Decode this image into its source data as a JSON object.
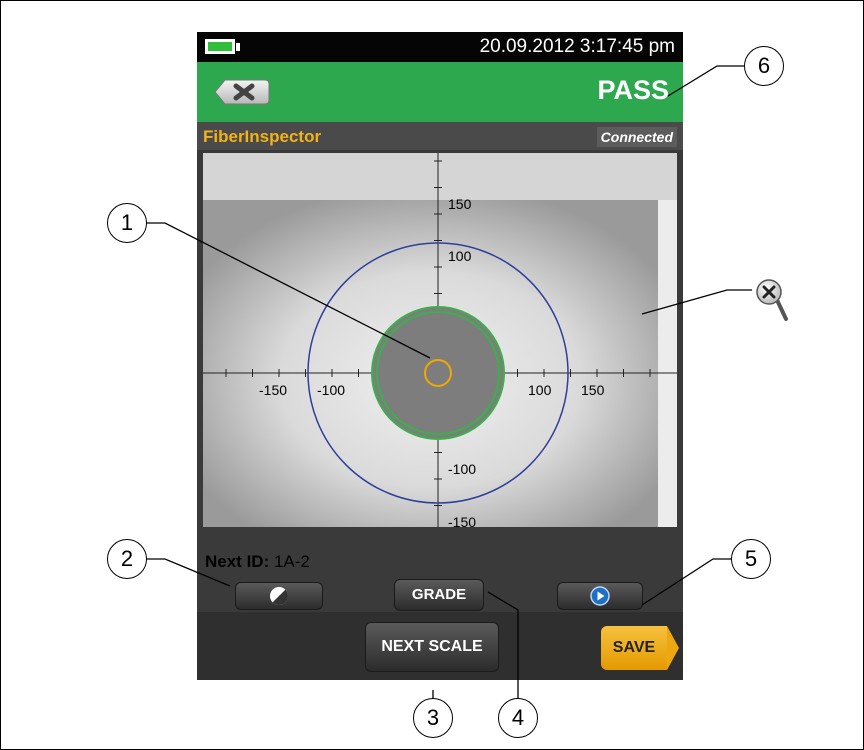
{
  "status_bar": {
    "datetime": "20.09.2012 3:17:45 pm",
    "battery_icon": "battery-full-icon"
  },
  "header": {
    "result": "PASS",
    "result_color": "#2da84f",
    "back_icon": "close-icon"
  },
  "app": {
    "title": "FiberInspector",
    "title_color": "#f2b21a",
    "connection": "Connected"
  },
  "plot": {
    "x_ticks": [
      "-150",
      "-100",
      "100",
      "150"
    ],
    "y_ticks": [
      "150",
      "100",
      "-100",
      "-150"
    ],
    "zoom_icon": "zoom-out-magnifier-icon"
  },
  "next_id": {
    "label": "Next ID:",
    "value": "1A-2"
  },
  "buttons": {
    "contrast_icon": "contrast-icon",
    "grade": "GRADE",
    "play_icon": "play-icon",
    "next_scale": "NEXT SCALE",
    "save": "SAVE"
  },
  "callouts": [
    "1",
    "2",
    "3",
    "4",
    "5",
    "6"
  ]
}
